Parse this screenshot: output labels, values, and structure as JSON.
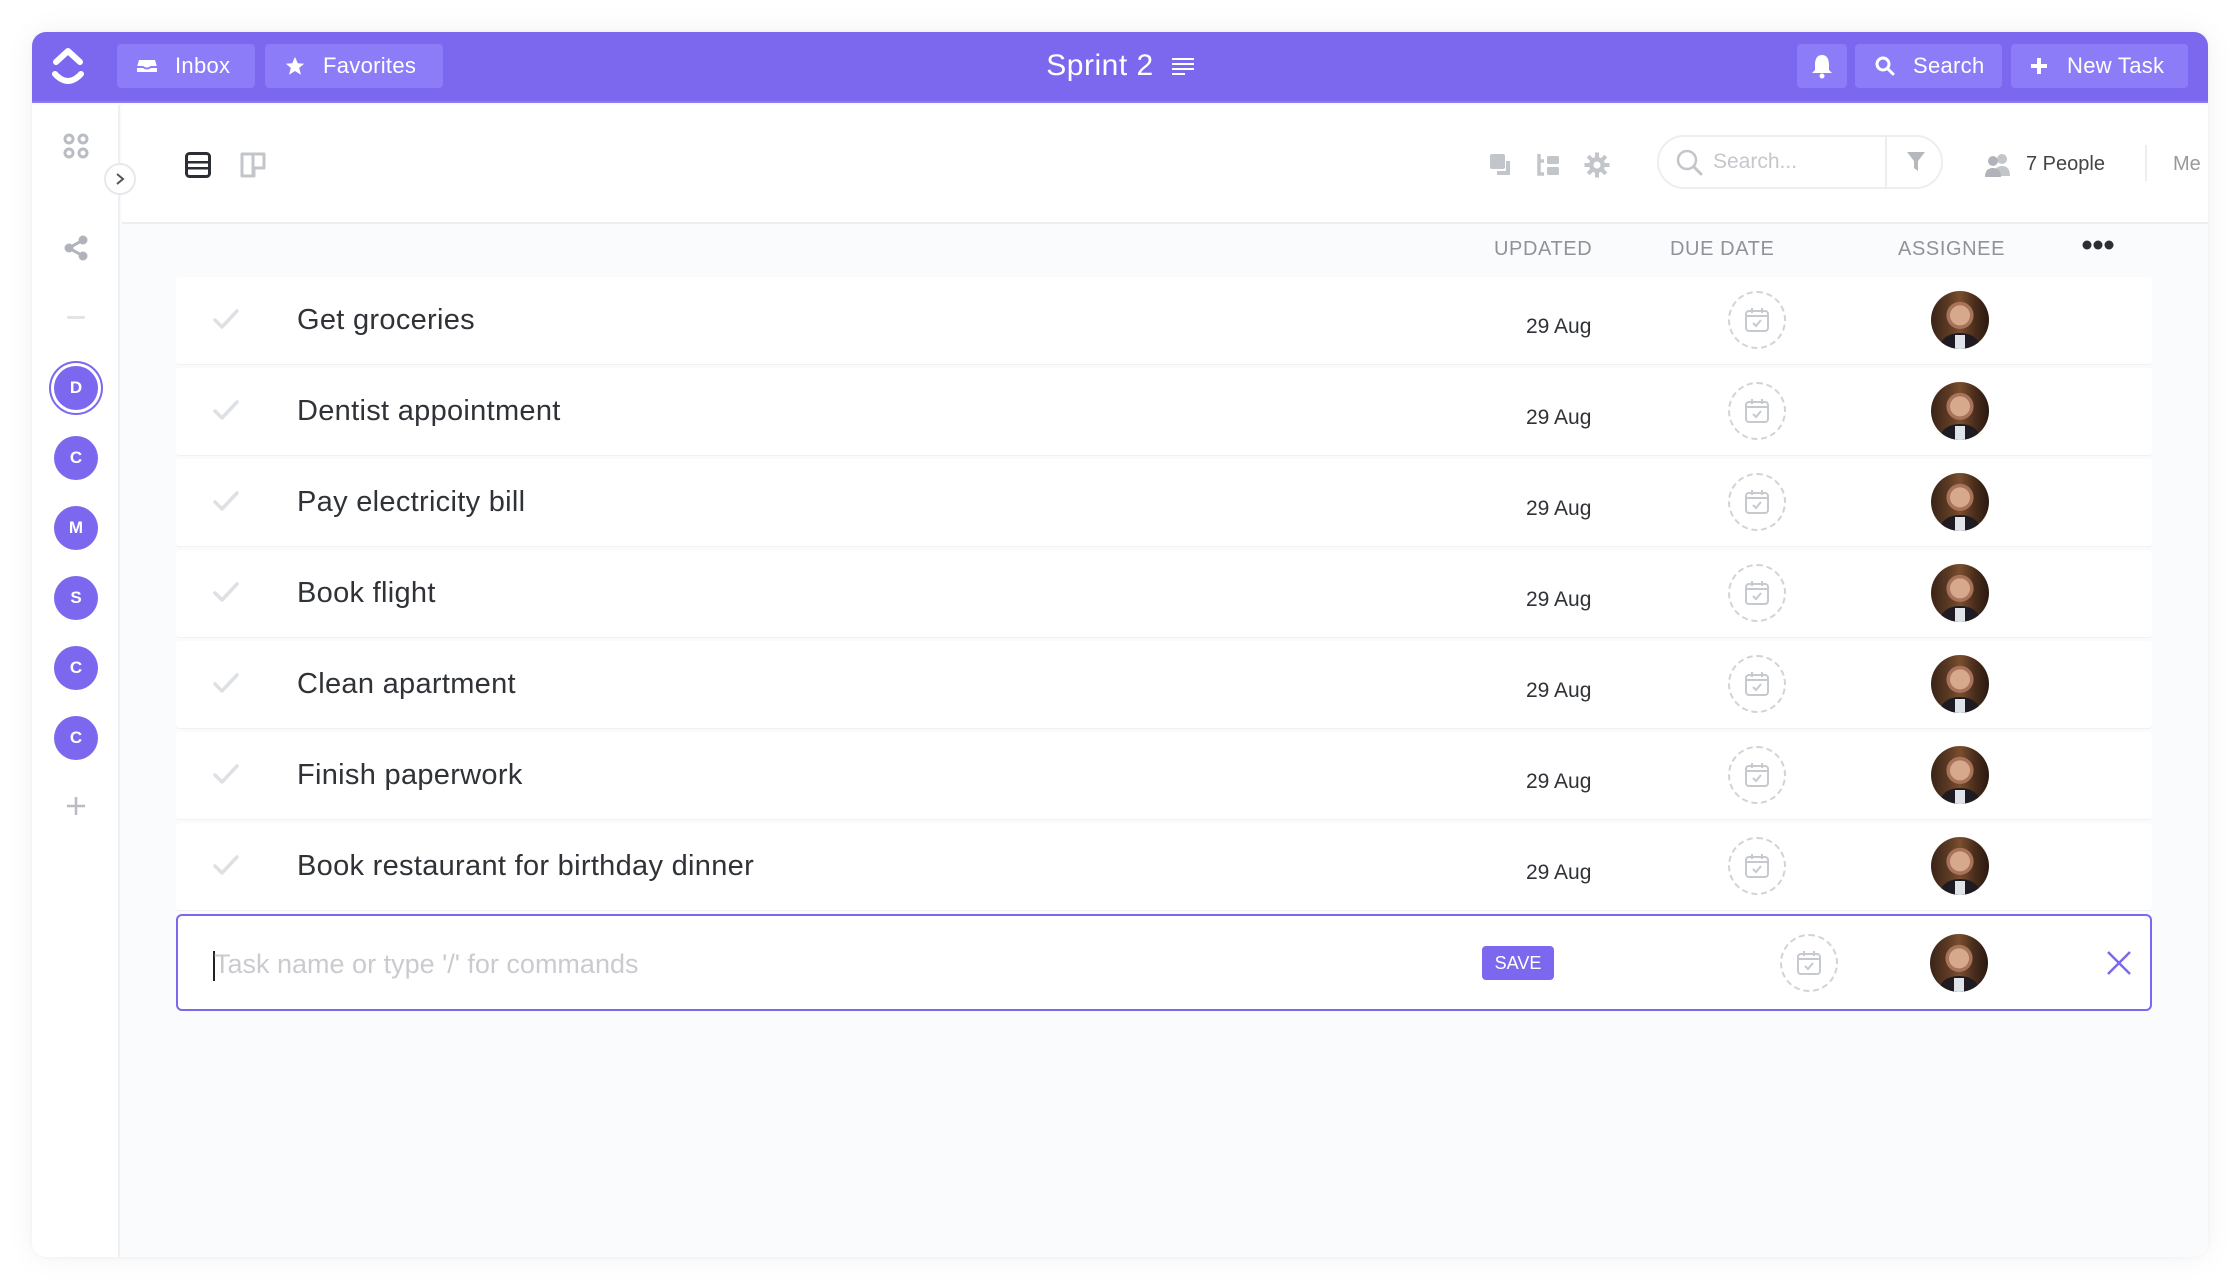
{
  "header": {
    "title": "Sprint 2",
    "inbox_label": "Inbox",
    "favorites_label": "Favorites",
    "search_label": "Search",
    "new_task_label": "New Task",
    "accent_color": "#7b68ee"
  },
  "toolbar": {
    "search_placeholder": "Search...",
    "people_label": "7 People",
    "me_label": "Me"
  },
  "sidebar": {
    "spaces": [
      {
        "initial": "D",
        "active": true
      },
      {
        "initial": "C",
        "active": false
      },
      {
        "initial": "M",
        "active": false
      },
      {
        "initial": "S",
        "active": false
      },
      {
        "initial": "C",
        "active": false
      },
      {
        "initial": "C",
        "active": false
      }
    ]
  },
  "list": {
    "columns": {
      "updated": "UPDATED",
      "due_date": "DUE DATE",
      "assignee": "ASSIGNEE"
    },
    "tasks": [
      {
        "name": "Get groceries",
        "updated": "29 Aug",
        "due_date": ""
      },
      {
        "name": "Dentist appointment",
        "updated": "29 Aug",
        "due_date": ""
      },
      {
        "name": "Pay electricity bill",
        "updated": "29 Aug",
        "due_date": ""
      },
      {
        "name": "Book flight",
        "updated": "29 Aug",
        "due_date": ""
      },
      {
        "name": "Clean apartment",
        "updated": "29 Aug",
        "due_date": ""
      },
      {
        "name": "Finish paperwork",
        "updated": "29 Aug",
        "due_date": ""
      },
      {
        "name": "Book restaurant for birthday dinner",
        "updated": "29 Aug",
        "due_date": ""
      }
    ]
  },
  "new_task": {
    "value": "",
    "placeholder": "Task name or type '/' for commands",
    "save_label": "SAVE"
  }
}
